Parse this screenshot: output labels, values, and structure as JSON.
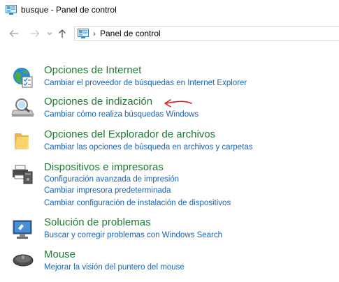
{
  "window": {
    "title": "busque - Panel de control"
  },
  "address": {
    "path": "Panel de control"
  },
  "items": [
    {
      "title": "Opciones de Internet",
      "icon": "internet-options-icon",
      "links": [
        "Cambiar el proveedor de búsquedas en Internet Explorer"
      ]
    },
    {
      "title": "Opciones de indización",
      "icon": "indexing-options-icon",
      "links": [
        "Cambiar cómo realiza búsquedas Windows"
      ]
    },
    {
      "title": "Opciones del Explorador de archivos",
      "icon": "folder-options-icon",
      "links": [
        "Cambiar las opciones de búsqueda en archivos y carpetas"
      ]
    },
    {
      "title": "Dispositivos e impresoras",
      "icon": "printer-icon",
      "links": [
        "Configuración avanzada de impresión",
        "Cambiar impresora predeterminada",
        "Cambiar configuración de instalación de dispositivos"
      ]
    },
    {
      "title": "Solución de problemas",
      "icon": "troubleshooting-icon",
      "links": [
        "Buscar y corregir problemas con Windows Search"
      ]
    },
    {
      "title": "Mouse",
      "icon": "mouse-icon",
      "links": [
        "Mejorar la visión del puntero del mouse"
      ]
    }
  ],
  "colors": {
    "title_green": "#1e7c34",
    "link_blue": "#1a63b4",
    "annotation_red": "#e0201e"
  }
}
